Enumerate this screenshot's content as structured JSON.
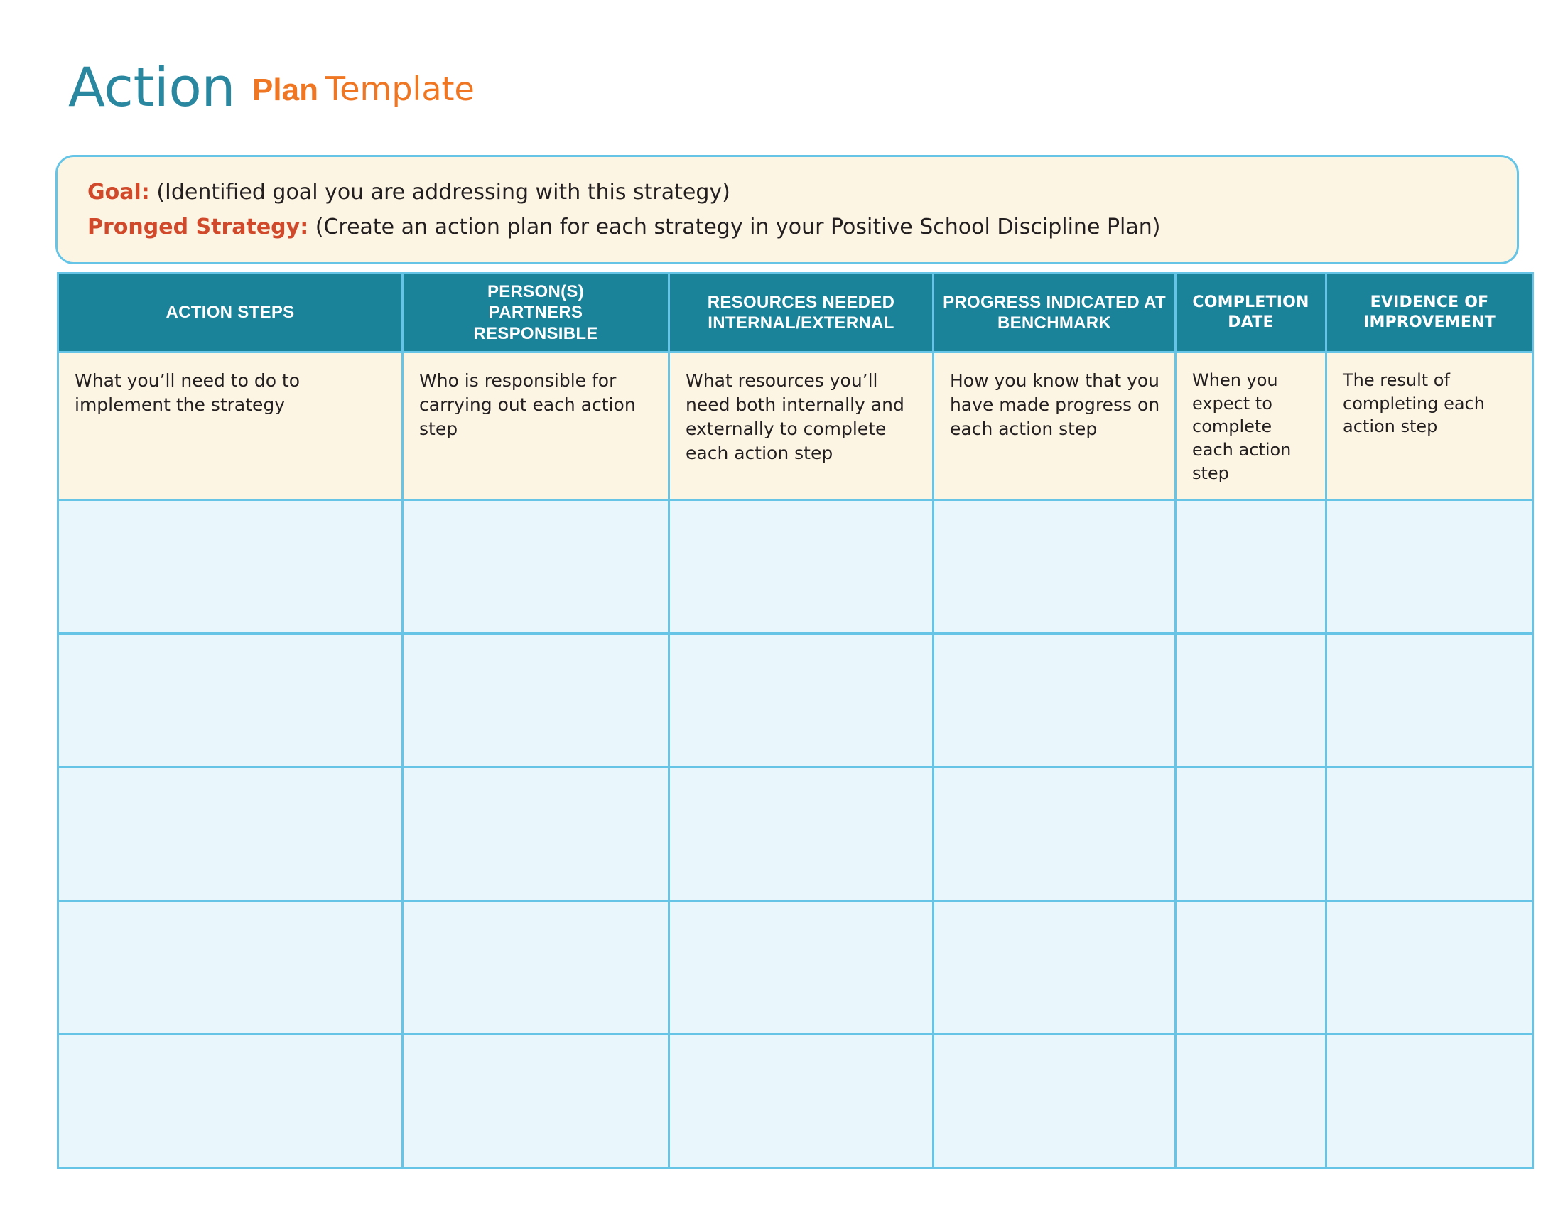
{
  "document": {
    "title_parts": {
      "action": "Action",
      "plan": "Plan",
      "template": "Template"
    }
  },
  "goal_box": {
    "goal_label": "Goal:",
    "goal_text": "(Identified goal you are addressing with this strategy)",
    "strategy_label": "Pronged Strategy:",
    "strategy_text": "(Create an action plan for each strategy in your Positive School Discipline Plan)"
  },
  "table": {
    "headers": [
      "ACTION STEPS",
      "PERSON(S)\nPARTNERS\nRESPONSIBLE",
      "RESOURCES NEEDED\nINTERNAL/EXTERNAL",
      "PROGRESS INDICATED AT\nBENCHMARK",
      "COMPLETION\nDATE",
      "EVIDENCE OF\nIMPROVEMENT"
    ],
    "header_lines": {
      "h1": [
        "ACTION STEPS"
      ],
      "h2": [
        "PERSON(S)",
        "PARTNERS",
        "RESPONSIBLE"
      ],
      "h3": [
        "RESOURCES NEEDED",
        "INTERNAL/EXTERNAL"
      ],
      "h4": [
        "PROGRESS INDICATED AT",
        "BENCHMARK"
      ],
      "h5": [
        "COMPLETION",
        "DATE"
      ],
      "h6": [
        "EVIDENCE OF",
        "IMPROVEMENT"
      ]
    },
    "description_row": [
      "What you’ll need to do to implement the strategy",
      "Who is responsible for carrying out each action step",
      "What resources you’ll need both internally and externally to complete each action step",
      "How you know that you have made progress on each action step",
      "When you expect to complete each action step",
      "The result of completing each action step"
    ],
    "blank_row_count": 5,
    "blank_cell_value": ""
  },
  "colors": {
    "teal_title": "#2a87a0",
    "orange": "#ef7622",
    "red_label": "#d0492b",
    "header_band": "#1a8299",
    "border_blue": "#66c5e6",
    "cream": "#fdf5e4",
    "light_blue": "#e9f6fc"
  }
}
